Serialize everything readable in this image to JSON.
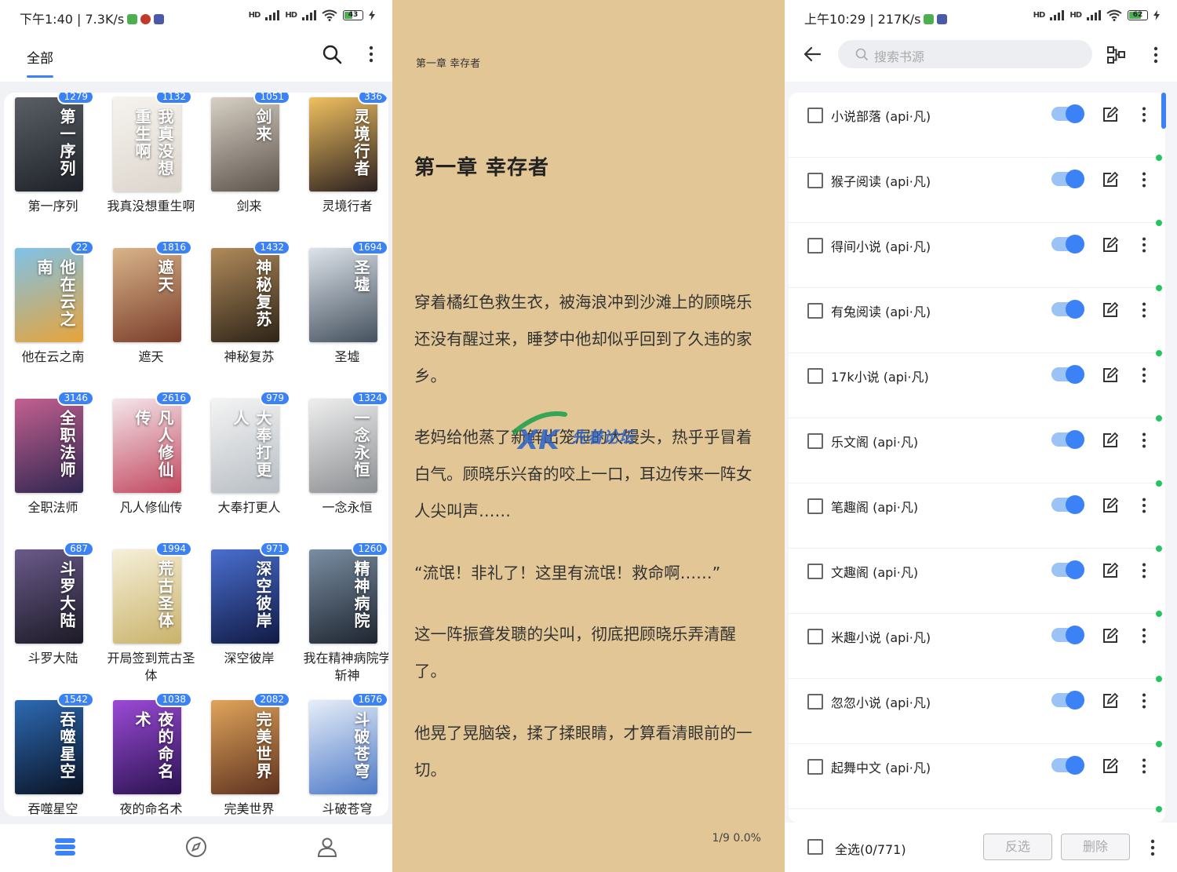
{
  "panel1": {
    "status": {
      "time": "下午1:40 | 7.3K/s",
      "battery": "43",
      "signal1": "HD",
      "signal2": "HD"
    },
    "tab": "全部",
    "books": [
      {
        "title": "第一序列",
        "count": "1279",
        "cover_text": "第一序列",
        "c1": "#5a5f66",
        "c2": "#1e2228"
      },
      {
        "title": "我真没想重生啊",
        "count": "1132",
        "cover_text": "我真没想重生啊",
        "c1": "#f6f3ef",
        "c2": "#dcd5cc"
      },
      {
        "title": "剑来",
        "count": "1051",
        "cover_text": "剑来",
        "c1": "#d7d0c4",
        "c2": "#5d544c"
      },
      {
        "title": "灵境行者",
        "count": "336",
        "cover_text": "灵境行者",
        "c1": "#f0c060",
        "c2": "#2a2020"
      },
      {
        "title": "他在云之南",
        "count": "22",
        "cover_text": "他在云之南",
        "c1": "#7fc2e8",
        "c2": "#e7a43a"
      },
      {
        "title": "遮天",
        "count": "1816",
        "cover_text": "遮天",
        "c1": "#d9b48a",
        "c2": "#7a3d2a"
      },
      {
        "title": "神秘复苏",
        "count": "1432",
        "cover_text": "神秘复苏",
        "c1": "#b08a5a",
        "c2": "#2e2418"
      },
      {
        "title": "圣墟",
        "count": "1694",
        "cover_text": "圣墟",
        "c1": "#dde3ea",
        "c2": "#44515e"
      },
      {
        "title": "全职法师",
        "count": "3146",
        "cover_text": "全职法师",
        "c1": "#c36090",
        "c2": "#2f2650"
      },
      {
        "title": "凡人修仙传",
        "count": "2616",
        "cover_text": "凡人修仙传",
        "c1": "#f4e6ea",
        "c2": "#c24860"
      },
      {
        "title": "大奉打更人",
        "count": "979",
        "cover_text": "大奉打更人",
        "c1": "#f4f4f4",
        "c2": "#b8bec4"
      },
      {
        "title": "一念永恒",
        "count": "1324",
        "cover_text": "一念永恒",
        "c1": "#eeeeee",
        "c2": "#8c8f92"
      },
      {
        "title": "斗罗大陆",
        "count": "687",
        "cover_text": "斗罗大陆",
        "c1": "#6a5a8a",
        "c2": "#1c1a26"
      },
      {
        "title": "开局签到荒古圣体",
        "count": "1994",
        "cover_text": "荒古圣体",
        "c1": "#f6f0da",
        "c2": "#c9b26a"
      },
      {
        "title": "深空彼岸",
        "count": "971",
        "cover_text": "深空彼岸",
        "c1": "#4a6fd0",
        "c2": "#111a44"
      },
      {
        "title": "我在精神病院学斩神",
        "count": "1260",
        "cover_text": "精神病院",
        "c1": "#7a8ea2",
        "c2": "#1e2530"
      },
      {
        "title": "吞噬星空",
        "count": "1542",
        "cover_text": "吞噬星空",
        "c1": "#2d6ab4",
        "c2": "#0a1324"
      },
      {
        "title": "夜的命名术",
        "count": "1038",
        "cover_text": "夜的命名术",
        "c1": "#9b4ad6",
        "c2": "#2a1350"
      },
      {
        "title": "完美世界",
        "count": "2082",
        "cover_text": "完美世界",
        "c1": "#e0a45a",
        "c2": "#5e3220"
      },
      {
        "title": "斗破苍穹",
        "count": "1676",
        "cover_text": "斗破苍穹",
        "c1": "#e6eef8",
        "c2": "#4e7ac8"
      }
    ]
  },
  "panel2": {
    "chapter_header": "第一章 幸存者",
    "title": "第一章 幸存者",
    "paragraphs": [
      "穿着橘红色救生衣，被海浪冲到沙滩上的顾晓乐还没有醒过来，睡梦中他却似乎回到了久违的家乡。",
      "老妈给他蒸了新鲜出笼屉的大馒头，热乎乎冒着白气。顾晓乐兴奋的咬上一口，耳边传来一阵女人尖叫声……",
      "“流氓！非礼了！这里有流氓！救命啊……”",
      "这一阵振聋发聩的尖叫，彻底把顾晓乐弄清醒了。",
      "他晃了晃脑袋，揉了揉眼睛，才算看清眼前的一切。"
    ],
    "footer": "1/9  0.0%",
    "watermark_text": "先着论坛"
  },
  "panel3": {
    "status": {
      "time": "上午10:29 | 217K/s",
      "battery": "62",
      "signal1": "HD",
      "signal2": "HD"
    },
    "search_placeholder": "搜索书源",
    "sources": [
      "小说部落 (api·凡)",
      "猴子阅读 (api·凡)",
      "得间小说 (api·凡)",
      "有兔阅读 (api·凡)",
      "17k小说 (api·凡)",
      "乐文阁 (api·凡)",
      "笔趣阁 (api·凡)",
      "文趣阁 (api·凡)",
      "米趣小说 (api·凡)",
      "忽忽小说 (api·凡)",
      "起舞中文 (api·凡)"
    ],
    "select_all": "全选(0/771)",
    "invert_label": "反选",
    "delete_label": "删除"
  },
  "colors": {
    "accent": "#3b82f6",
    "reader_bg": "#e3c696",
    "online": "#22c55e"
  }
}
